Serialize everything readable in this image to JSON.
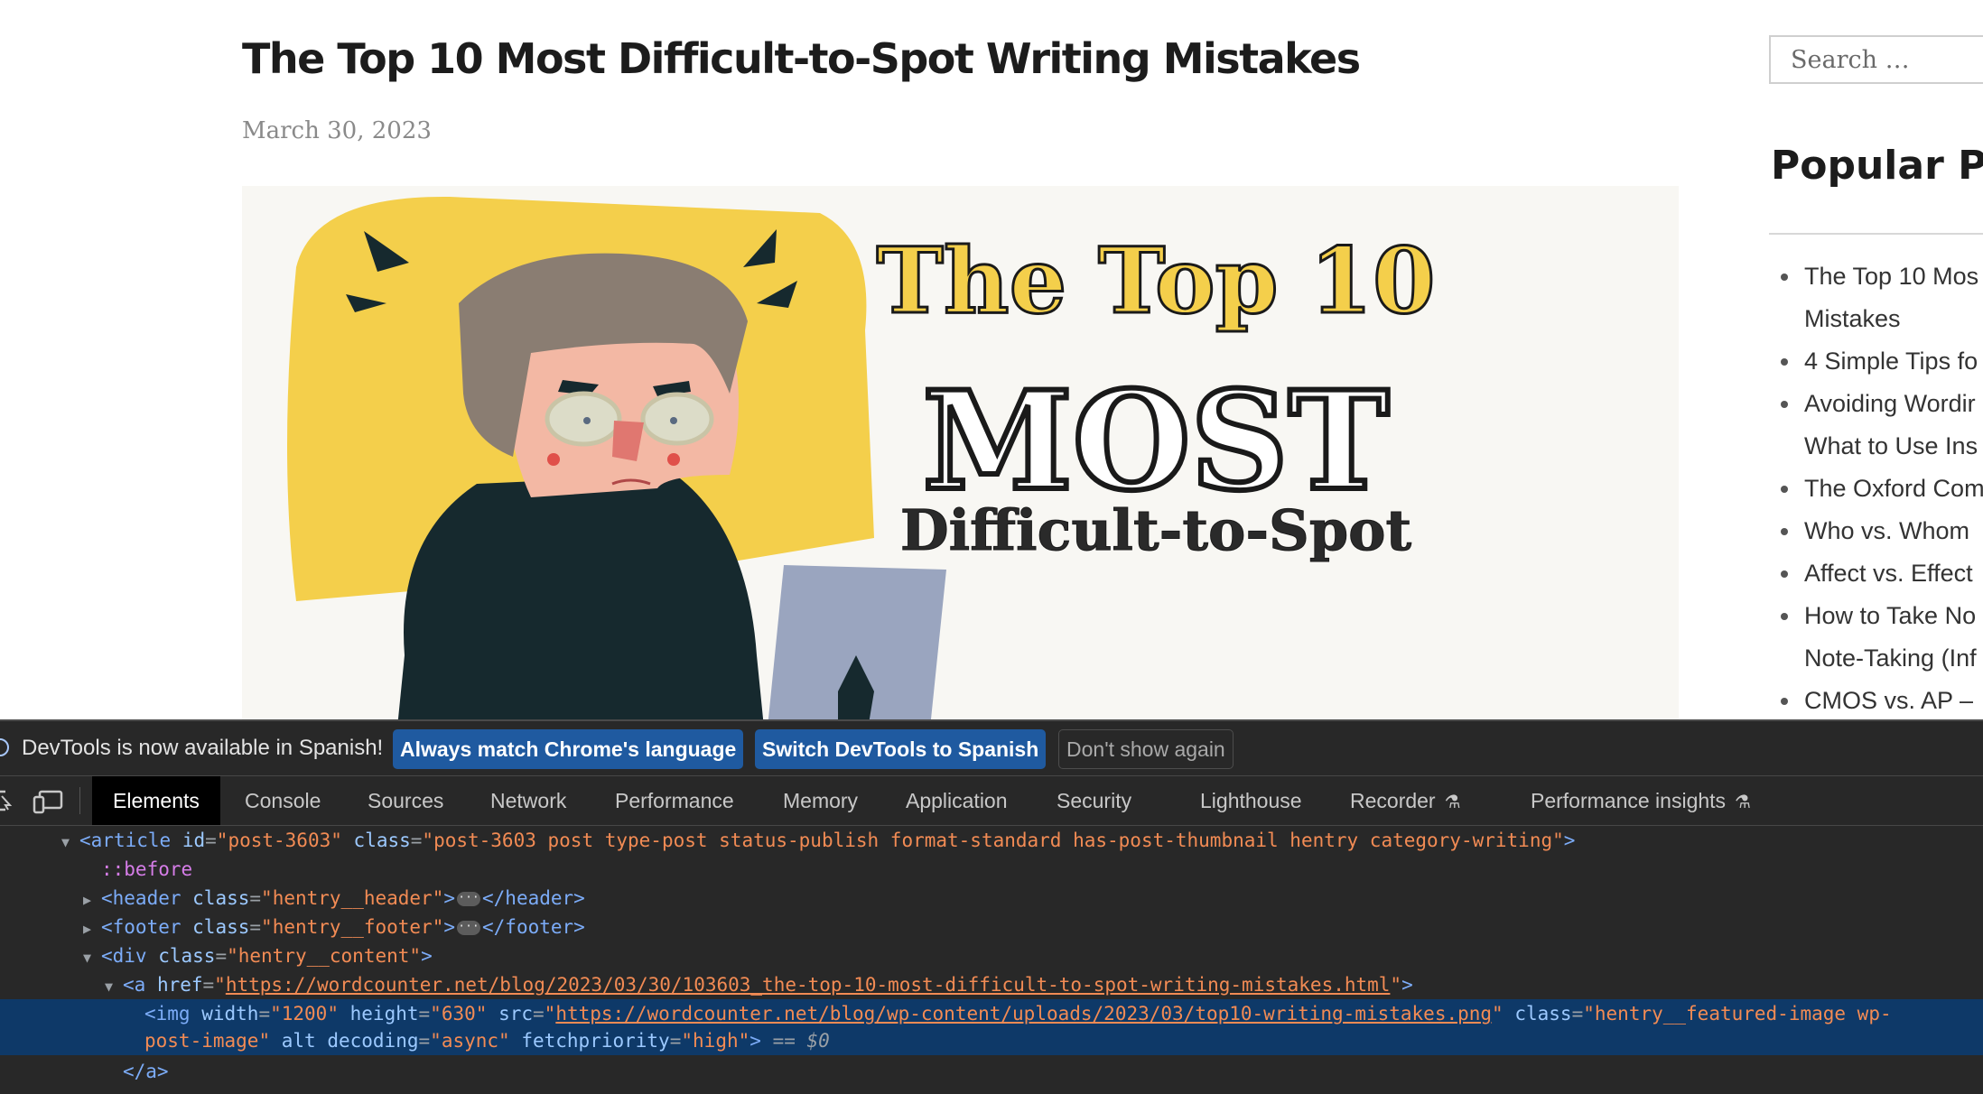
{
  "page": {
    "title": "The Top 10 Most Difficult-to-Spot Writing Mistakes",
    "date": "March 30, 2023",
    "featured_image": {
      "line1": "The Top 10",
      "line2": "MOST",
      "line3": "Difficult-to-Spot",
      "colors": {
        "yellow": "#f4cf4b",
        "jacket": "#16292e",
        "skin": "#f3b8a4",
        "hair": "#8a7d72",
        "laptop": "#9aa5bf"
      }
    }
  },
  "sidebar": {
    "search_placeholder": "Search …",
    "popular_heading": "Popular Po",
    "items": [
      "The Top 10 Mos",
      "Mistakes",
      "4 Simple Tips fo",
      "Avoiding Wordir",
      "What to Use Ins",
      "The Oxford Com",
      "Who vs. Whom",
      "Affect vs. Effect",
      "How to Take No",
      "Note-Taking (Inf",
      "CMOS vs. AP –"
    ]
  },
  "devtools": {
    "infobar": {
      "icon": "info-icon",
      "message": "DevTools is now available in Spanish!",
      "match_label": "Always match Chrome's language",
      "switch_label": "Switch DevTools to Spanish",
      "dont_show_label": "Don't show again"
    },
    "toolbar_icons": [
      "inspect-element-icon",
      "device-toolbar-icon"
    ],
    "tabs": [
      "Elements",
      "Console",
      "Sources",
      "Network",
      "Performance",
      "Memory",
      "Application",
      "Security",
      "Lighthouse",
      "Recorder",
      "Performance insights"
    ],
    "active_tab": "Elements",
    "dom": {
      "article_tag": "article",
      "article_id_attr": "id",
      "article_id": "post-3603",
      "article_class_attr": "class",
      "article_class": "post-3603 post type-post status-publish format-standard has-post-thumbnail hentry category-writing",
      "before": "::before",
      "header_class": "hentry__header",
      "footer_class": "hentry__footer",
      "content_class": "hentry__content",
      "a_href": "https://wordcounter.net/blog/2023/03/30/103603_the-top-10-most-difficult-to-spot-writing-mistakes.html",
      "img_width": "1200",
      "img_height": "630",
      "img_src": "https://wordcounter.net/blog/wp-content/uploads/2023/03/top10-writing-mistakes.png",
      "img_class_part1": "hentry__featured-image wp-",
      "img_class_part2": "post-image",
      "img_decoding": "async",
      "img_fetchpriority": "high",
      "selected_marker": "== $0",
      "a_close": "</a>"
    }
  }
}
